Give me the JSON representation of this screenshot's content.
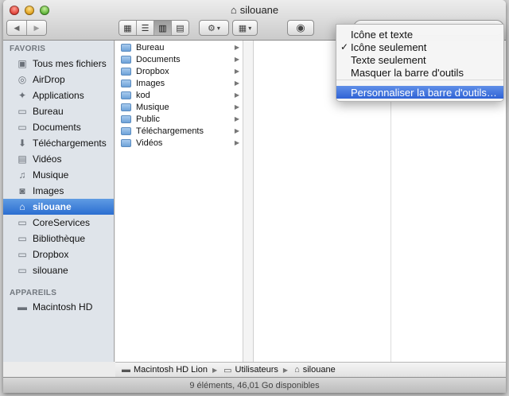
{
  "window": {
    "title": "silouane"
  },
  "toolbar": {
    "back": "◀",
    "forward": "▶"
  },
  "sidebar": {
    "favorites_header": "FAVORIS",
    "favorites": [
      {
        "label": "Tous mes fichiers",
        "icon": "all-files-icon"
      },
      {
        "label": "AirDrop",
        "icon": "airdrop-icon"
      },
      {
        "label": "Applications",
        "icon": "applications-icon"
      },
      {
        "label": "Bureau",
        "icon": "folder-icon"
      },
      {
        "label": "Documents",
        "icon": "folder-icon"
      },
      {
        "label": "Téléchargements",
        "icon": "download-icon"
      },
      {
        "label": "Vidéos",
        "icon": "video-icon"
      },
      {
        "label": "Musique",
        "icon": "music-icon"
      },
      {
        "label": "Images",
        "icon": "camera-icon"
      },
      {
        "label": "silouane",
        "icon": "home-icon",
        "selected": true
      },
      {
        "label": "CoreServices",
        "icon": "folder-icon"
      },
      {
        "label": "Bibliothèque",
        "icon": "folder-icon"
      },
      {
        "label": "Dropbox",
        "icon": "folder-icon"
      },
      {
        "label": "silouane",
        "icon": "folder-icon"
      }
    ],
    "devices_header": "APPAREILS",
    "devices": [
      {
        "label": "Macintosh HD",
        "icon": "harddisk-icon"
      }
    ]
  },
  "files": [
    "Bureau",
    "Documents",
    "Dropbox",
    "Images",
    "kod",
    "Musique",
    "Public",
    "Téléchargements",
    "Vidéos"
  ],
  "pathbar": [
    "Macintosh HD Lion",
    "Utilisateurs",
    "silouane"
  ],
  "status": "9 éléments, 46,01 Go disponibles",
  "menu": {
    "items": [
      {
        "label": "Icône et texte",
        "checked": false
      },
      {
        "label": "Icône seulement",
        "checked": true
      },
      {
        "label": "Texte seulement",
        "checked": false
      },
      {
        "label": "Masquer la barre d'outils",
        "checked": false
      }
    ],
    "customize": "Personnaliser la barre d'outils…"
  },
  "colors": {
    "selection": "#2b6ed1",
    "sidebar": "#dfe4ea"
  }
}
